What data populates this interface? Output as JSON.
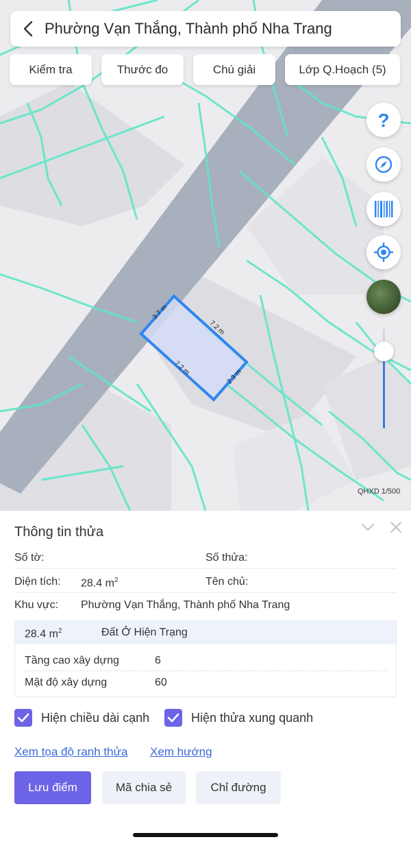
{
  "header": {
    "location_title": "Phường Vạn Thắng, Thành phố Nha Trang",
    "back_icon": "chevron-left-icon"
  },
  "toolbar": {
    "buttons": [
      "Kiểm tra",
      "Thước đo",
      "Chú giải",
      "Lớp Q.Hoạch (5)"
    ]
  },
  "map": {
    "help_icon": "question-icon",
    "compass_icon": "compass-icon",
    "barcode_icon": "barcode-icon",
    "locate_icon": "locate-icon",
    "satellite_icon": "satellite-layer-icon",
    "scale_label": "QHXD 1/500",
    "zoom_level": 0.78,
    "parcel_edges": [
      "3.7 m",
      "7.2 m",
      "7.2 m",
      "2.3 m"
    ],
    "colors": {
      "parcel_outline": "#2f86f0",
      "road": "#a8b0bd",
      "planning_lines": "#5fe6c8"
    }
  },
  "sheet": {
    "title": "Thông tin thửa",
    "so_to_label": "Số tờ:",
    "so_to_value": "",
    "so_thua_label": "Số thửa:",
    "so_thua_value": "",
    "dien_tich_label": "Diện tích:",
    "dien_tich_value": "28.4 m",
    "dien_tich_sup": "2",
    "ten_chu_label": "Tên chủ:",
    "ten_chu_value": "",
    "khu_vuc_label": "Khu vực:",
    "khu_vuc_value": "Phường Vạn Thắng, Thành phố Nha Trang",
    "landuse": {
      "area": "28.4 m",
      "area_sup": "2",
      "type": "Đất Ở Hiện Trạng",
      "tang_cao_label": "Tầng cao xây dựng",
      "tang_cao_value": "6",
      "mat_do_label": "Mật độ xây dựng",
      "mat_do_value": "60"
    },
    "checkbox_1": "Hiện chiều dài cạnh",
    "checkbox_2": "Hiện thửa xung quanh",
    "link_1": "Xem tọa độ ranh thửa",
    "link_2": "Xem hướng",
    "btn_save": "Lưu điểm",
    "btn_share": "Mã chia sẻ",
    "btn_route": "Chỉ đường",
    "colors": {
      "accent": "#6c63e6",
      "link": "#3a6bd6"
    }
  }
}
